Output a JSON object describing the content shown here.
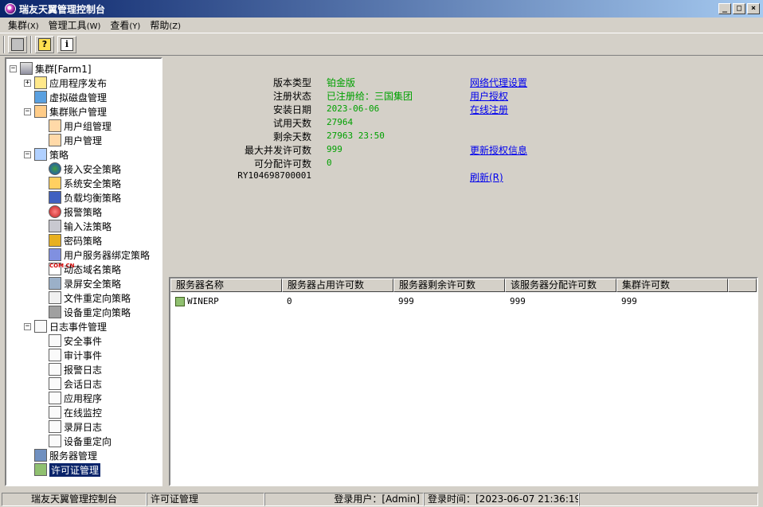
{
  "window": {
    "title": "瑞友天翼管理控制台",
    "min": "_",
    "max": "□",
    "close": "×"
  },
  "menu": [
    {
      "label": "集群",
      "acc": "(X)"
    },
    {
      "label": "管理工具",
      "acc": "(W)"
    },
    {
      "label": "查看",
      "acc": "(Y)"
    },
    {
      "label": "帮助",
      "acc": "(Z)"
    }
  ],
  "toolbar": {
    "help_glyph": "?",
    "info_glyph": "i"
  },
  "tree": {
    "root": "集群[Farm1]",
    "items": [
      {
        "label": "应用程序发布"
      },
      {
        "label": "虚拟磁盘管理"
      },
      {
        "label": "集群账户管理"
      },
      {
        "label": "用户组管理"
      },
      {
        "label": "用户管理"
      },
      {
        "label": "策略"
      },
      {
        "label": "接入安全策略"
      },
      {
        "label": "系统安全策略"
      },
      {
        "label": "负载均衡策略"
      },
      {
        "label": "报警策略"
      },
      {
        "label": "输入法策略"
      },
      {
        "label": "密码策略"
      },
      {
        "label": "用户服务器绑定策略"
      },
      {
        "label": "动态域名策略"
      },
      {
        "label": "录屏安全策略"
      },
      {
        "label": "文件重定向策略"
      },
      {
        "label": "设备重定向策略"
      },
      {
        "label": "日志事件管理"
      },
      {
        "label": "安全事件"
      },
      {
        "label": "审计事件"
      },
      {
        "label": "报警日志"
      },
      {
        "label": "会话日志"
      },
      {
        "label": "应用程序"
      },
      {
        "label": "在线监控"
      },
      {
        "label": "录屏日志"
      },
      {
        "label": "设备重定向"
      },
      {
        "label": "服务器管理"
      },
      {
        "label": "许可证管理"
      }
    ],
    "com_icon_text": "COM CN"
  },
  "info": {
    "rows": [
      {
        "label": "版本类型",
        "value": "铂金版",
        "link": "网络代理设置"
      },
      {
        "label": "注册状态",
        "value": "已注册给：三国集团",
        "link": "用户授权"
      },
      {
        "label": "安装日期",
        "value": "2023-06-06",
        "link": "在线注册"
      },
      {
        "label": "试用天数",
        "value": "27964",
        "link": ""
      },
      {
        "label": "剩余天数",
        "value": "27963 23:50",
        "link": ""
      },
      {
        "label": "最大并发许可数",
        "value": "999",
        "link": "更新授权信息"
      },
      {
        "label": "可分配许可数",
        "value": "0",
        "link": ""
      },
      {
        "label": "RY104698700001",
        "value": "",
        "link": "刷新(R)"
      }
    ]
  },
  "list": {
    "columns": [
      "服务器名称",
      "服务器占用许可数",
      "服务器剩余许可数",
      "该服务器分配许可数",
      "集群许可数"
    ],
    "rows": [
      [
        "WINERP",
        "0",
        "999",
        "999",
        "999"
      ]
    ]
  },
  "status": {
    "app": "瑞友天翼管理控制台",
    "section": "许可证管理",
    "user": "登录用户：[Admin]",
    "time": "登录时间：[2023-06-07 21:36:19]"
  }
}
